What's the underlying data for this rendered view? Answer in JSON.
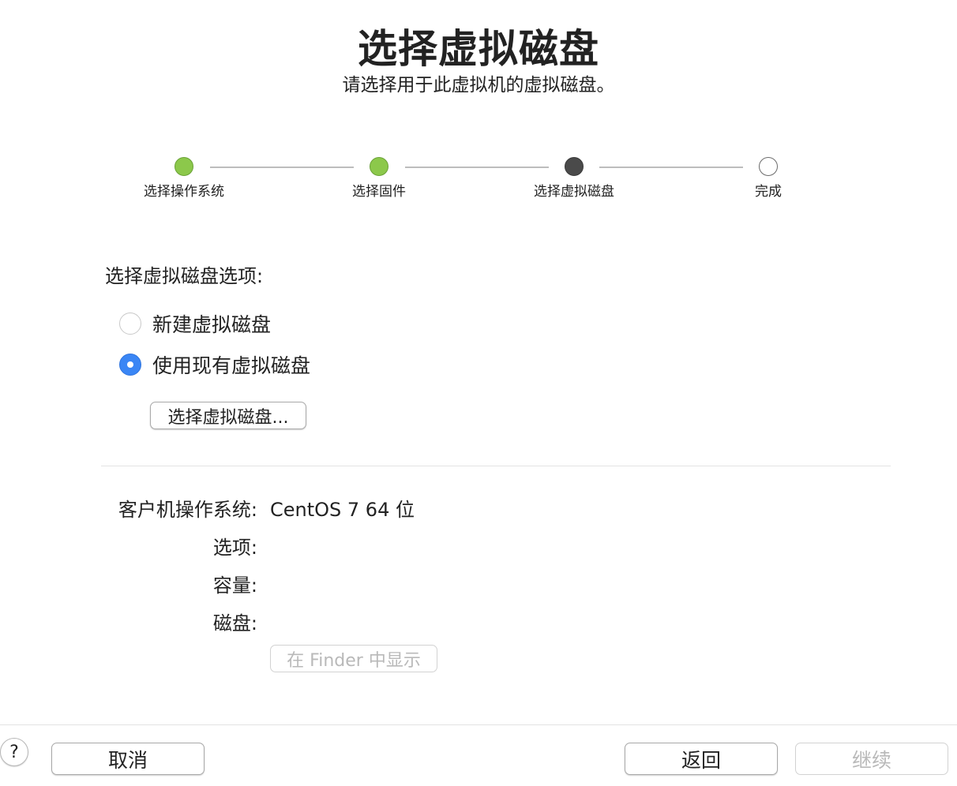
{
  "header": {
    "title": "选择虚拟磁盘",
    "subtitle": "请选择用于此虚拟机的虚拟磁盘。"
  },
  "stepper": {
    "steps": [
      {
        "label": "选择操作系统",
        "state": "done"
      },
      {
        "label": "选择固件",
        "state": "done"
      },
      {
        "label": "选择虚拟磁盘",
        "state": "current"
      },
      {
        "label": "完成",
        "state": "todo"
      }
    ]
  },
  "options": {
    "section_label": "选择虚拟磁盘选项:",
    "radio_new": {
      "label": "新建虚拟磁盘",
      "checked": false
    },
    "radio_existing": {
      "label": "使用现有虚拟磁盘",
      "checked": true
    },
    "choose_button": "选择虚拟磁盘..."
  },
  "info": {
    "os_label": "客户机操作系统:",
    "os_value": "CentOS 7 64 位",
    "options_label": "选项:",
    "capacity_label": "容量:",
    "disk_label": "磁盘:",
    "finder_button": "在 Finder 中显示"
  },
  "footer": {
    "help": "?",
    "cancel": "取消",
    "back": "返回",
    "continue": "继续"
  },
  "colors": {
    "step_done": "#8cc84b",
    "step_current": "#4a4a4a",
    "radio_accent": "#3a86f5"
  }
}
